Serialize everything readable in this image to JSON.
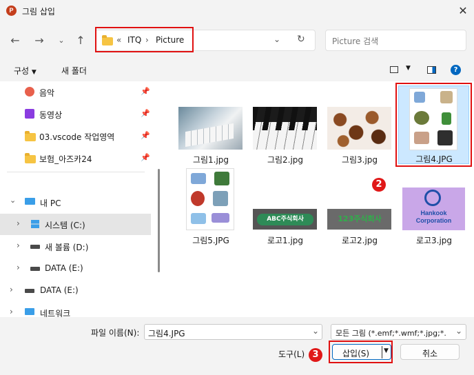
{
  "window": {
    "title": "그림 삽입",
    "app_icon_letter": "P"
  },
  "address": {
    "separator": "«",
    "crumbs": [
      "ITQ",
      "Picture"
    ],
    "chevron": "›"
  },
  "search": {
    "placeholder": "Picture 검색"
  },
  "toolbar": {
    "organize": "구성",
    "new_folder": "새 폴더"
  },
  "sidebar": {
    "quick": [
      {
        "label": "음악",
        "icon": "music-icon"
      },
      {
        "label": "동영상",
        "icon": "video-icon"
      },
      {
        "label": "03.vscode 작업영역",
        "icon": "folder-icon"
      },
      {
        "label": "보험_아즈카24",
        "icon": "folder-icon"
      }
    ],
    "this_pc": "내 PC",
    "drives": [
      {
        "label": "시스템 (C:)",
        "selected": true
      },
      {
        "label": "새 볼륨 (D:)",
        "selected": false
      },
      {
        "label": "DATA (E:)",
        "selected": false
      }
    ],
    "data_drive": "DATA (E:)",
    "network": "네트워크"
  },
  "files": [
    {
      "name": "그림1.jpg",
      "thumb": "keyboard"
    },
    {
      "name": "그림2.jpg",
      "thumb": "piano"
    },
    {
      "name": "그림3.jpg",
      "thumb": "coffee"
    },
    {
      "name": "그림4.JPG",
      "thumb": "clipart-collage",
      "selected": true
    },
    {
      "name": "그림5.JPG",
      "thumb": "clipart-collage-2"
    },
    {
      "name": "로고1.jpg",
      "thumb": "logo-abc",
      "logo_text": "ABC주식회사"
    },
    {
      "name": "로고2.jpg",
      "thumb": "logo-123",
      "logo_text": "123주식회사"
    },
    {
      "name": "로고3.jpg",
      "thumb": "logo-hankook",
      "logo_text": "Hankook Corporation"
    }
  ],
  "bottom": {
    "filename_label": "파일 이름(N):",
    "filename_value": "그림4.JPG",
    "filetype_value": "모든 그림 (*.emf;*.wmf;*.jpg;*.",
    "tools_label": "도구(L)",
    "insert_label": "삽입(S)",
    "cancel_label": "취소"
  },
  "badges": {
    "two": "2",
    "three": "3"
  },
  "colors": {
    "highlight": "#e01010",
    "selection": "#cce8ff",
    "accent": "#0067c0"
  }
}
